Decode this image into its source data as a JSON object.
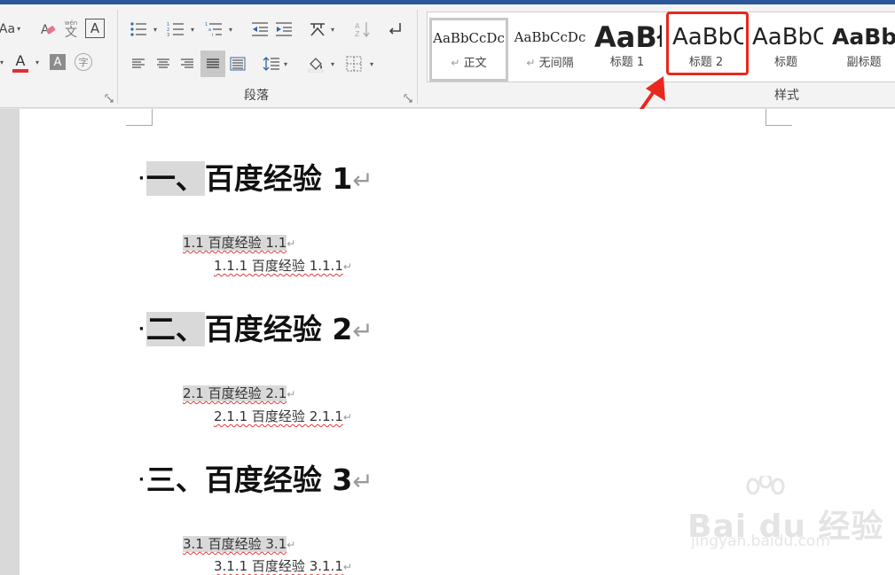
{
  "ribbon": {
    "font_group": {
      "case_button": "Aa",
      "font_color": "#e03030",
      "highlight_char": "A",
      "char_shade_label": "A",
      "enclose_char": "字",
      "phonetic_char": "文",
      "phonetic_top": "wén",
      "border_char": "A"
    },
    "paragraph_group": {
      "label": "段落"
    },
    "styles_group": {
      "label": "样式",
      "items": [
        {
          "preview": "AaBbCcDc",
          "label": "正文",
          "mark": "↵"
        },
        {
          "preview": "AaBbCcDc",
          "label": "无间隔",
          "mark": "↵"
        },
        {
          "preview": "AaBł",
          "label": "标题 1"
        },
        {
          "preview": "AaBbC",
          "label": "标题 2"
        },
        {
          "preview": "AaBbC",
          "label": "标题"
        },
        {
          "preview": "AaBbC",
          "label": "副标题"
        }
      ]
    }
  },
  "accent_colors": {
    "highlight_box": "#e8281d",
    "arrow": "#e8281d",
    "title_strip": "#2b579a"
  },
  "document": {
    "sections": [
      {
        "h1_number": "一、",
        "h1_text": "百度经验 1",
        "h2_text": "1.1 百度经验 1.1",
        "h3_text": "1.1.1 百度经验 1.1.1"
      },
      {
        "h1_number": "二、",
        "h1_text": "百度经验 2",
        "h2_text": "2.1 百度经验 2.1",
        "h3_text": "2.1.1 百度经验 2.1.1"
      },
      {
        "h1_number": "三、",
        "h1_text": "百度经验 3",
        "h2_text": "3.1 百度经验 3.1",
        "h3_text": "3.1.1 百度经验 3.1.1"
      }
    ],
    "bullet": "·",
    "para_mark": "↵"
  },
  "watermark": {
    "logo": "Bai du 经验",
    "url": "jingyan.baidu.com"
  }
}
